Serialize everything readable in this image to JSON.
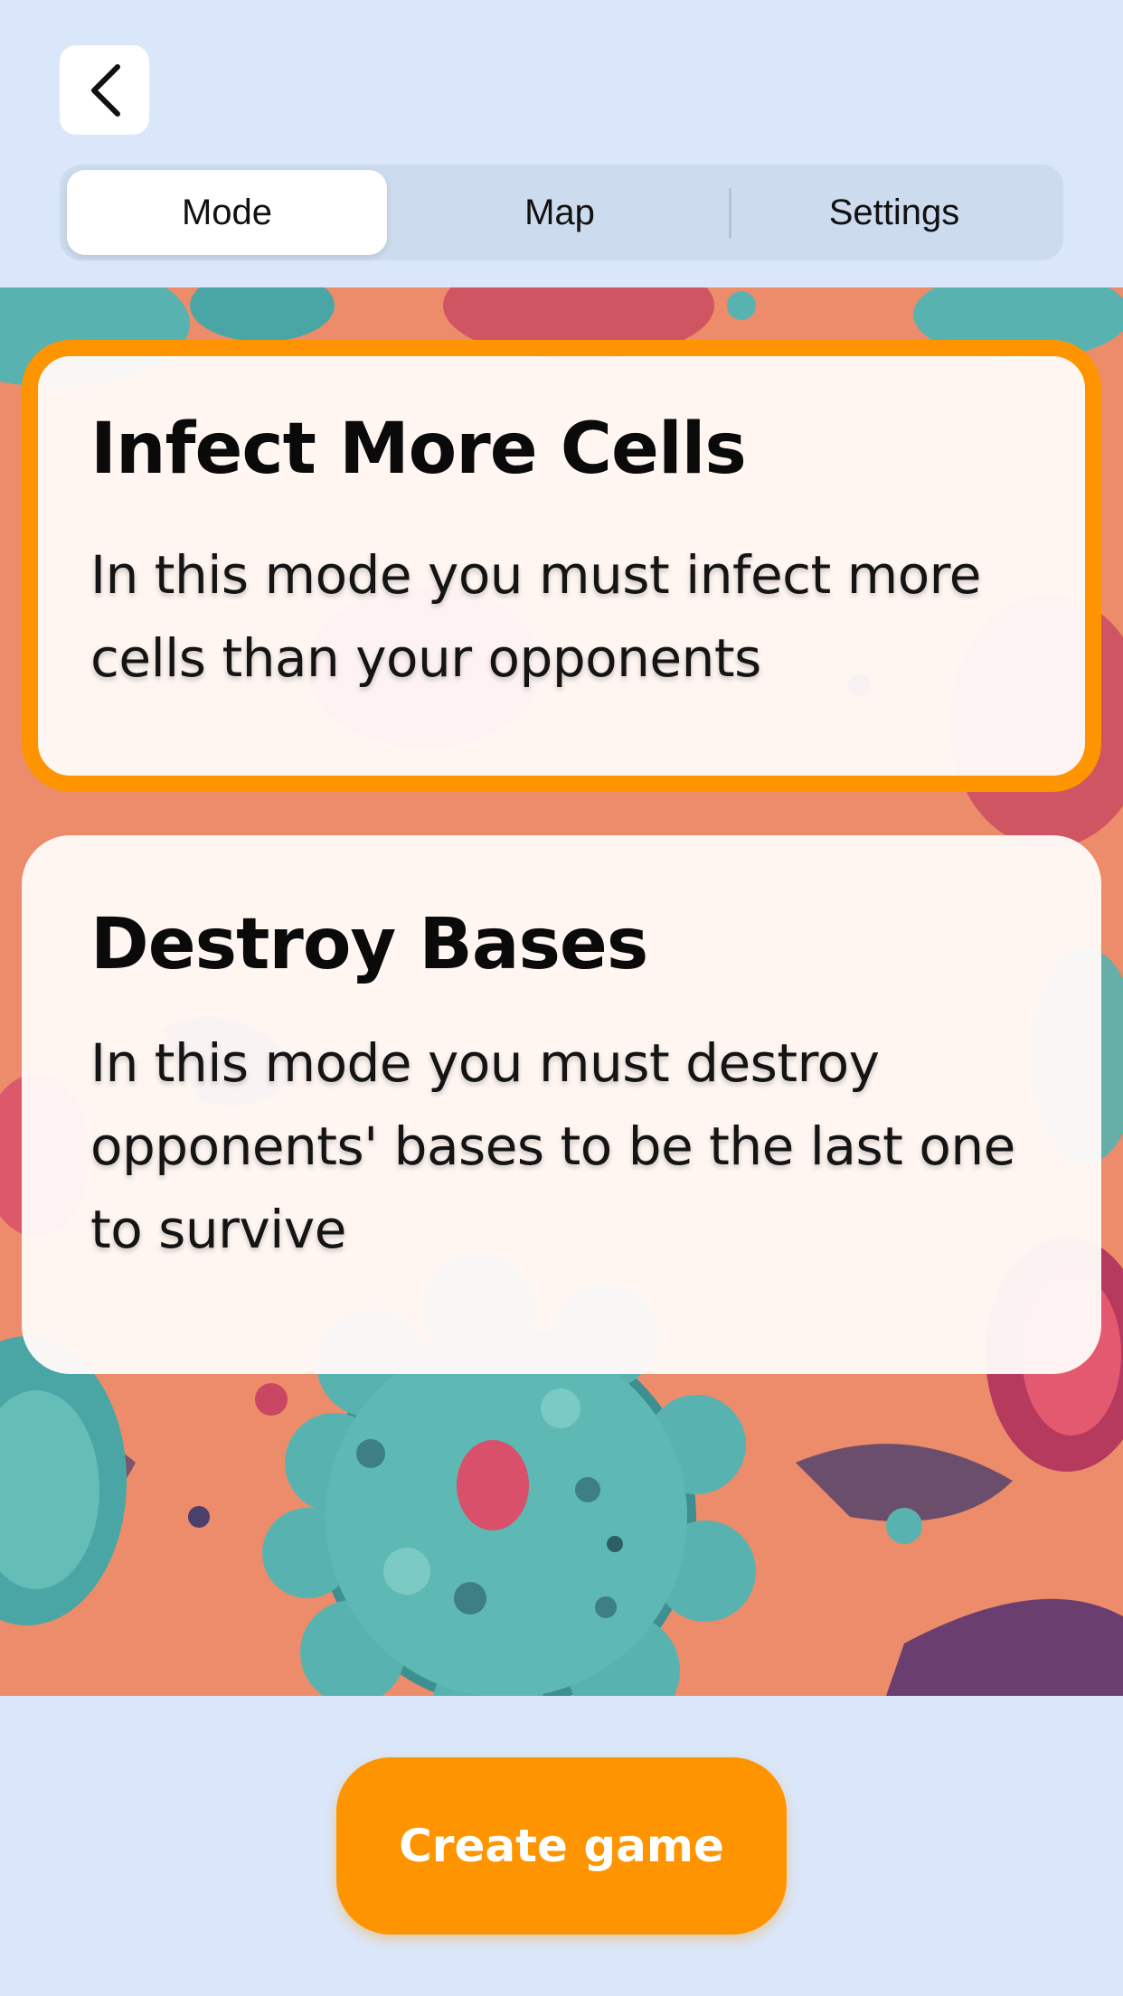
{
  "nav": {
    "back_icon": "chevron-left-icon"
  },
  "tabs": [
    {
      "label": "Mode",
      "selected": true
    },
    {
      "label": "Map",
      "selected": false
    },
    {
      "label": "Settings",
      "selected": false
    }
  ],
  "modes": [
    {
      "title": "Infect More Cells",
      "description": "In this mode you must infect more cells than your opponents",
      "selected": true
    },
    {
      "title": "Destroy Bases",
      "description": "In this mode you must destroy opponents' bases to be the last one to survive",
      "selected": false
    }
  ],
  "footer": {
    "create_label": "Create game"
  },
  "colors": {
    "accent": "#fe9500",
    "page_background": "#dae7fa",
    "segmented_background": "#cddbee",
    "art_background": "#ec8c6a",
    "cell_teal": "#58b3b0",
    "cell_pink": "#d8506a"
  }
}
